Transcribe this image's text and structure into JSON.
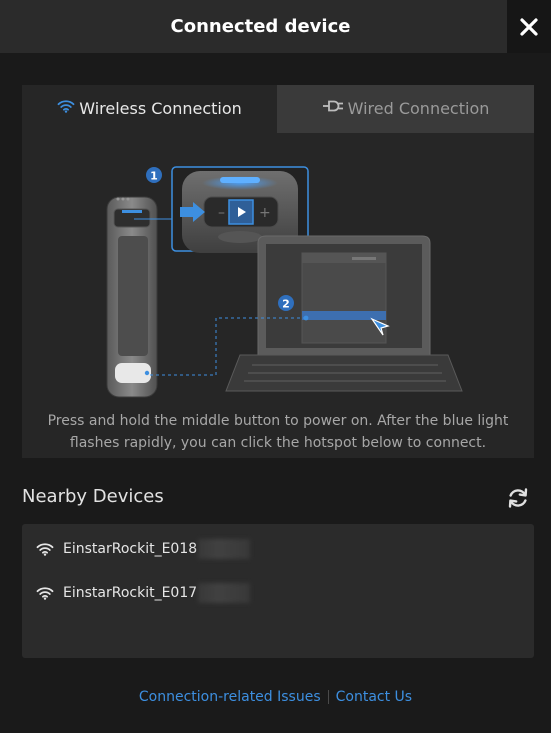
{
  "window": {
    "title": "Connected device"
  },
  "tabs": [
    {
      "label": "Wireless Connection",
      "icon": "wifi-icon",
      "active": true
    },
    {
      "label": "Wired Connection",
      "icon": "plug-icon",
      "active": false
    }
  ],
  "illustration": {
    "step1": "1",
    "step2": "2",
    "instruction": "Press and hold the middle button to power on. After the blue light flashes rapidly, you can click the hotspot below to connect."
  },
  "nearby": {
    "title": "Nearby Devices",
    "refresh_icon": "refresh-icon",
    "devices": [
      {
        "name": "EinstarRockit_E018",
        "icon": "wifi-icon"
      },
      {
        "name": "EinstarRockit_E017",
        "icon": "wifi-icon"
      }
    ]
  },
  "footer": {
    "issues_link": "Connection-related Issues",
    "contact_link": "Contact Us"
  },
  "colors": {
    "accent": "#3d8fe0",
    "highlight_blue": "#2f7de0",
    "background": "#1a1a1a",
    "panel": "#262626"
  }
}
